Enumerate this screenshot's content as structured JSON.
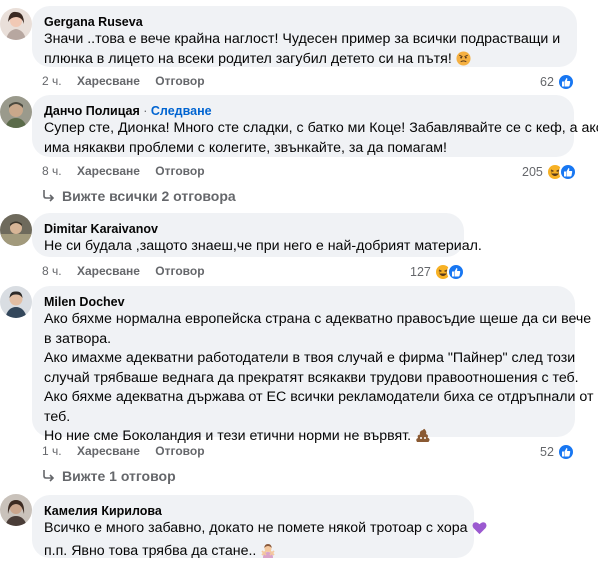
{
  "comments": [
    {
      "author": "Gergana Ruseva",
      "lines": [
        "Значи ..това е вече крайна наглост! Чудесен пример за всички подрастващи и",
        "плюнка в лицето на всеки родител загубил детето си на пътя!"
      ],
      "inline_emoji": "angry-face",
      "time": "2 ч.",
      "like_label": "Харесване",
      "reply_label": "Отговор",
      "reaction_count": "62",
      "reactions": [
        "like"
      ]
    },
    {
      "author": "Данчо Полицая",
      "follow_label": "Следване",
      "lines": [
        "Супер сте, Дионка! Много сте сладки, с батко ми Коце! Забавлявайте се с кеф, а ако",
        "има някакви проблеми с колегите, звънкайте, за да помагам!"
      ],
      "time": "8 ч.",
      "like_label": "Харесване",
      "reply_label": "Отговор",
      "reaction_count": "205",
      "reactions": [
        "haha",
        "like"
      ],
      "view_replies": "Вижте всички 2 отговора"
    },
    {
      "author": "Dimitar Karaivanov",
      "lines": [
        "Не си будала ,защото знаеш,че при него е най-добрият материал."
      ],
      "time": "8 ч.",
      "like_label": "Харесване",
      "reply_label": "Отговор",
      "reaction_count": "127",
      "reactions": [
        "haha",
        "like"
      ]
    },
    {
      "author": "Milen Dochev",
      "lines": [
        "Ако бяхме нормална европейска страна с адекватно правосъдие щеше да си вече",
        "в затвора.",
        "Ако имахме адекватни работодатели в твоя случай е фирма \"Пайнер\" след този",
        "случай трябваше веднага да прекратят всякакви трудови правоотношения с теб.",
        "Ако бяхме адекватна държава от ЕС всички рекламодатели биха се отдръпнали от",
        "теб.",
        "Но ние сме Боколандия и тези етични норми не вървят."
      ],
      "inline_emoji": "pile-of-poo",
      "time": "1 ч.",
      "like_label": "Харесване",
      "reply_label": "Отговор",
      "reaction_count": "52",
      "reactions": [
        "like"
      ],
      "view_replies": "Вижте 1 отговор"
    },
    {
      "author": "Камелия Кирилова",
      "lines": [
        "Всичко е много забавно, докато не помете някой тротоар с хора",
        "п.п. Явно това трябва да стане.."
      ],
      "inline_emojis": [
        "purple-heart",
        "person-gesturing-no"
      ]
    }
  ],
  "colors": {
    "bubble_bg": "#f0f2f5",
    "meta_text": "#65676b",
    "follow": "#0064d1",
    "like_blue": "#1877f2",
    "haha_yellow": "#f7b125"
  }
}
